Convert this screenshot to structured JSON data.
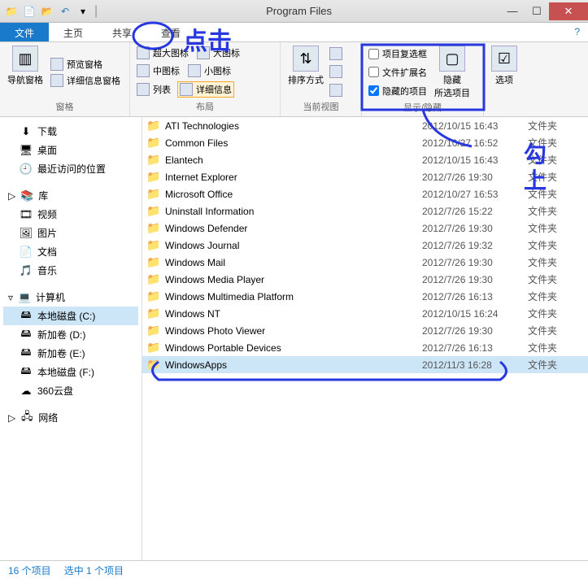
{
  "titlebar": {
    "title": "Program Files"
  },
  "tabs": {
    "file": "文件",
    "home": "主页",
    "share": "共享",
    "view": "查看"
  },
  "ribbon": {
    "nav_pane": "导航窗格",
    "preview_pane": "预览窗格",
    "details_pane": "详细信息窗格",
    "panes_label": "窗格",
    "xl_icons": "超大图标",
    "l_icons": "大图标",
    "m_icons": "中图标",
    "s_icons": "小图标",
    "list": "列表",
    "details": "详细信息",
    "layout_label": "布局",
    "sort_by": "排序方式",
    "current_view_label": "当前视图",
    "chk_item_checkboxes": "项目复选框",
    "chk_file_ext": "文件扩展名",
    "chk_hidden": "隐藏的项目",
    "hide_selected": "隐藏\n所选项目",
    "show_hide_label": "显示/隐藏",
    "options": "选项"
  },
  "sidebar": {
    "downloads": "下载",
    "desktop": "桌面",
    "recent": "最近访问的位置",
    "libraries": "库",
    "videos": "视频",
    "pictures": "图片",
    "documents": "文档",
    "music": "音乐",
    "computer": "计算机",
    "drive_c": "本地磁盘 (C:)",
    "drive_d": "新加卷 (D:)",
    "drive_e": "新加卷 (E:)",
    "drive_f": "本地磁盘 (F:)",
    "cloud360": "360云盘",
    "network": "网络"
  },
  "files": [
    {
      "name": "ATI Technologies",
      "date": "2012/10/15 16:43",
      "type": "文件夹"
    },
    {
      "name": "Common Files",
      "date": "2012/10/27 16:52",
      "type": "文件夹"
    },
    {
      "name": "Elantech",
      "date": "2012/10/15 16:43",
      "type": "文件夹"
    },
    {
      "name": "Internet Explorer",
      "date": "2012/7/26 19:30",
      "type": "文件夹"
    },
    {
      "name": "Microsoft Office",
      "date": "2012/10/27 16:53",
      "type": "文件夹"
    },
    {
      "name": "Uninstall Information",
      "date": "2012/7/26 15:22",
      "type": "文件夹"
    },
    {
      "name": "Windows Defender",
      "date": "2012/7/26 19:30",
      "type": "文件夹"
    },
    {
      "name": "Windows Journal",
      "date": "2012/7/26 19:32",
      "type": "文件夹"
    },
    {
      "name": "Windows Mail",
      "date": "2012/7/26 19:30",
      "type": "文件夹"
    },
    {
      "name": "Windows Media Player",
      "date": "2012/7/26 19:30",
      "type": "文件夹"
    },
    {
      "name": "Windows Multimedia Platform",
      "date": "2012/7/26 16:13",
      "type": "文件夹"
    },
    {
      "name": "Windows NT",
      "date": "2012/10/15 16:24",
      "type": "文件夹"
    },
    {
      "name": "Windows Photo Viewer",
      "date": "2012/7/26 19:30",
      "type": "文件夹"
    },
    {
      "name": "Windows Portable Devices",
      "date": "2012/7/26 16:13",
      "type": "文件夹"
    },
    {
      "name": "WindowsApps",
      "date": "2012/11/3 16:28",
      "type": "文件夹",
      "selected": true
    }
  ],
  "status": {
    "count": "16 个项目",
    "selection": "选中 1 个项目"
  },
  "annotations": {
    "click": "点击",
    "tick": "勾上"
  }
}
